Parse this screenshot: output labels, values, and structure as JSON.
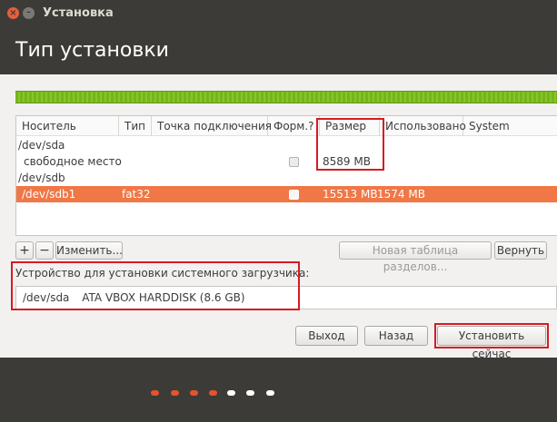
{
  "window": {
    "title": "Установка",
    "close_glyph": "×",
    "minimize_glyph": "–"
  },
  "header": {
    "title": "Тип установки"
  },
  "progress": {
    "fraction": 1.0,
    "color": "#75b51b"
  },
  "table": {
    "columns": [
      "Носитель",
      "Тип",
      "Точка подключения",
      "Форм.?",
      "Размер",
      "Использовано",
      "System"
    ],
    "rows": [
      {
        "device": "/dev/sda",
        "type": "",
        "mount": "",
        "format": null,
        "size": "",
        "used": "",
        "system": ""
      },
      {
        "device": "свободное место",
        "type": "",
        "mount": "",
        "format": false,
        "size": "8589 MB",
        "used": "",
        "system": ""
      },
      {
        "device": "/dev/sdb",
        "type": "",
        "mount": "",
        "format": null,
        "size": "",
        "used": "",
        "system": ""
      },
      {
        "device": "/dev/sdb1",
        "type": "fat32",
        "mount": "",
        "format": false,
        "size": "15513 MB",
        "used": "1574 MB",
        "system": "",
        "selected": true
      }
    ]
  },
  "toolbar": {
    "add": "+",
    "remove": "−",
    "change": "Изменить...",
    "new_table": "Новая таблица разделов...",
    "revert": "Вернуть"
  },
  "bootloader": {
    "label": "Устройство для установки системного загрузчика:",
    "device": "/dev/sda",
    "description": "ATA VBOX HARDDISK (8.6 GB)"
  },
  "buttons": {
    "quit": "Выход",
    "back": "Назад",
    "install": "Установить сейчас"
  },
  "steps": {
    "total": 7,
    "done": 4
  },
  "colors": {
    "accent": "#f07746",
    "highlight_box": "#d71a21",
    "step_done": "#e5532d",
    "step_todo": "#ffffff",
    "chrome": "#3c3b37"
  }
}
